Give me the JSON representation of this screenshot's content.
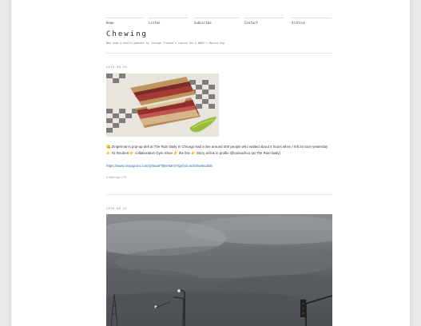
{
  "nav": {
    "items": [
      {
        "label": "Home"
      },
      {
        "label": "Listen"
      },
      {
        "label": "Subscribe"
      },
      {
        "label": "Contact"
      },
      {
        "label": "Archive"
      }
    ]
  },
  "blog": {
    "title": "Chewing",
    "tagline": "New food & health podcast by Chicago Tribune's Louisa Chu & WBEZ's Monica Eng"
  },
  "posts": [
    {
      "date": "2018-08-26",
      "caption": "😋 Zingerman's pop-up deli at The Ruin Daily in Chicago had a line around 400 people who waited about 4 hours when I left at noon yesterday 👉 #2 Reuben 👉 collaboration Gym Shoe 👉 the line 👉 Story at link in profile @louisachu1 (at The Ruin Daily)",
      "link": "https://www.instagram.com/p/BwaFfl88AMm/?igshid=mxihhw8vu8d6",
      "meta": "4 days ago  |  ⟲2"
    },
    {
      "date": "2018-08-26"
    }
  ],
  "colors": {
    "link": "#2a6fb2",
    "background": "#e9e9e9",
    "page": "#ffffff"
  }
}
